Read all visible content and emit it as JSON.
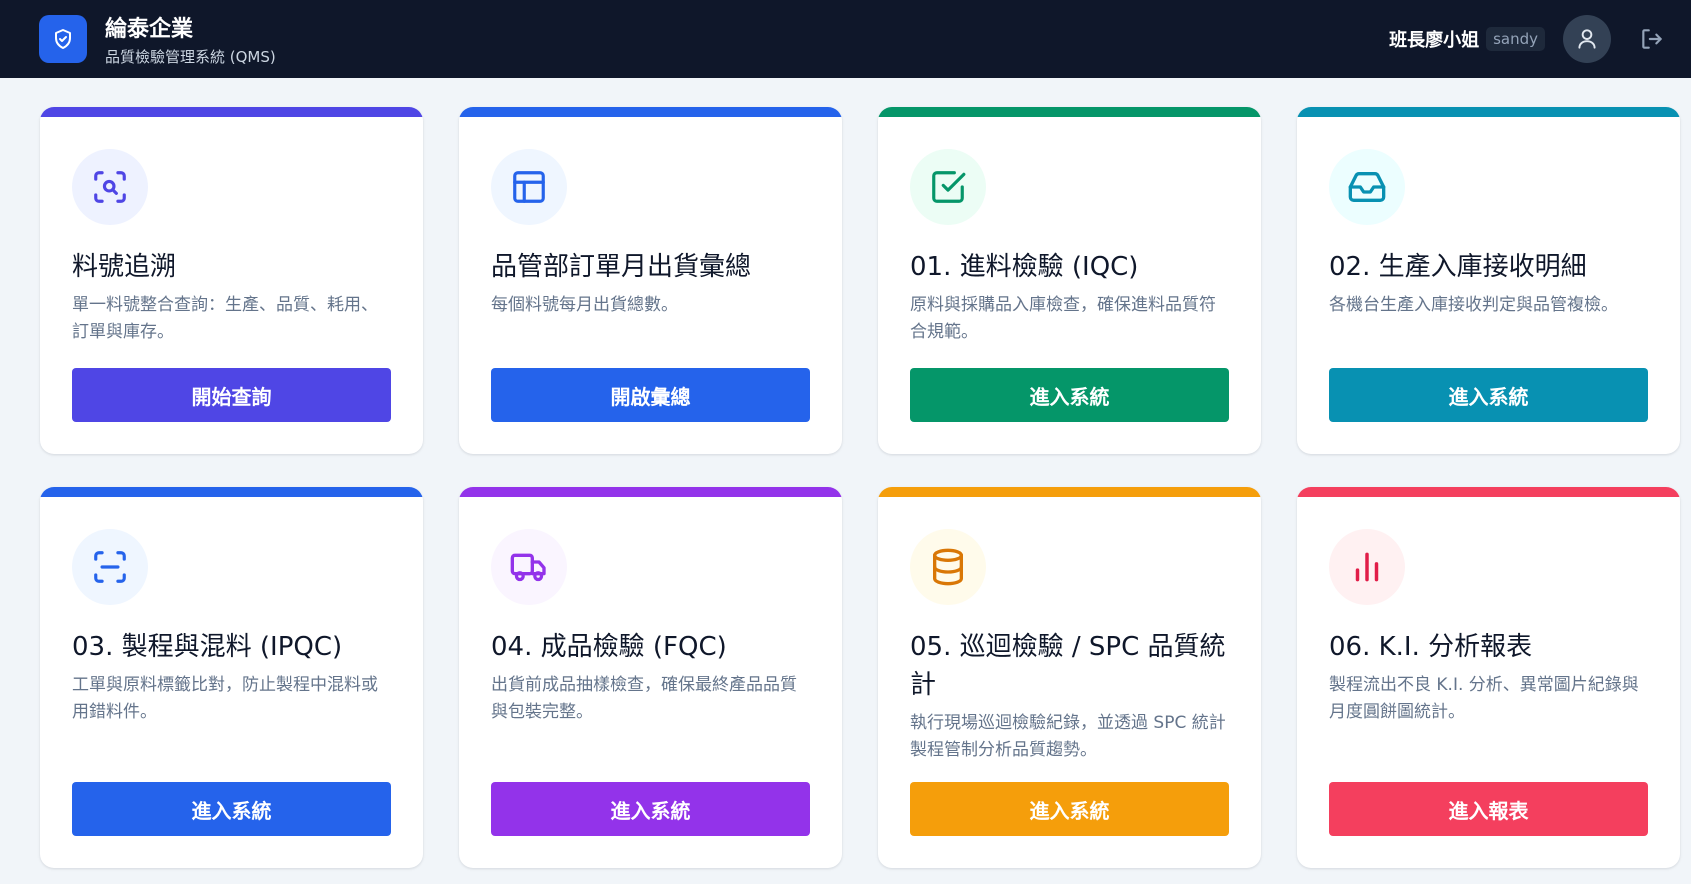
{
  "header": {
    "company": "綸泰企業",
    "subtitle": "品質檢驗管理系統 (QMS)",
    "user_name": "班長廖小姐",
    "user_id": "sandy"
  },
  "cards": [
    {
      "title": "料號追溯",
      "desc": "單一料號整合查詢：生產、品質、耗用、訂單與庫存。",
      "button": "開始查詢",
      "icon": "search-scan-icon",
      "accent": "#4f46e5",
      "tint": "#eef2ff"
    },
    {
      "title": "品管部訂單月出貨彙總",
      "desc": "每個料號每月出貨總數。",
      "button": "開啟彙總",
      "icon": "table-layout-icon",
      "accent": "#2563eb",
      "tint": "#eff6ff"
    },
    {
      "title": "01. 進料檢驗 (IQC)",
      "desc": "原料與採購品入庫檢查，確保進料品質符合規範。",
      "button": "進入系統",
      "icon": "checkbox-icon",
      "accent": "#059669",
      "tint": "#ecfdf5"
    },
    {
      "title": "02. 生產入庫接收明細",
      "desc": "各機台生產入庫接收判定與品管複檢。",
      "button": "進入系統",
      "icon": "inbox-icon",
      "accent": "#0891b2",
      "tint": "#ecfeff"
    },
    {
      "title": "03. 製程與混料 (IPQC)",
      "desc": "工單與原料標籤比對，防止製程中混料或用錯料件。",
      "button": "進入系統",
      "icon": "scan-line-icon",
      "accent": "#2563eb",
      "tint": "#eff6ff"
    },
    {
      "title": "04. 成品檢驗 (FQC)",
      "desc": "出貨前成品抽樣檢查，確保最終產品品質與包裝完整。",
      "button": "進入系統",
      "icon": "truck-icon",
      "accent": "#9333ea",
      "tint": "#faf5ff"
    },
    {
      "title": "05. 巡迴檢驗 / SPC 品質統計",
      "desc": "執行現場巡迴檢驗紀錄，並透過 SPC 統計製程管制分析品質趨勢。",
      "button": "進入系統",
      "icon": "database-icon",
      "accent": "#f59e0b",
      "tint": "#fffbeb"
    },
    {
      "title": "06. K.I. 分析報表",
      "desc": "製程流出不良 K.I. 分析、異常圖片紀錄與月度圓餅圖統計。",
      "button": "進入報表",
      "icon": "bar-chart-icon",
      "accent": "#f43f5e",
      "tint": "#fff1f2"
    }
  ]
}
